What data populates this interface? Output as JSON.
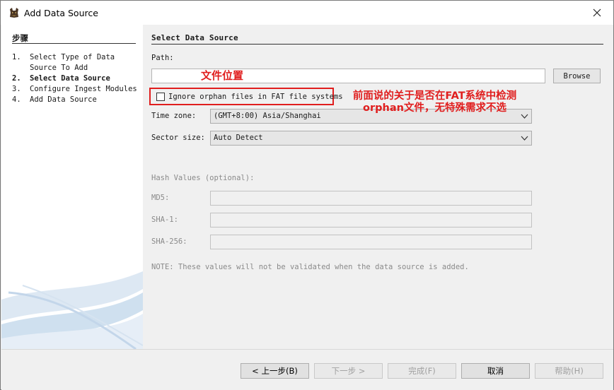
{
  "window": {
    "title": "Add Data Source"
  },
  "steps": {
    "heading": "步骤",
    "items": [
      {
        "num": "1.",
        "label": "Select Type of Data Source To Add",
        "active": false
      },
      {
        "num": "2.",
        "label": "Select Data Source",
        "active": true
      },
      {
        "num": "3.",
        "label": "Configure Ingest Modules",
        "active": false
      },
      {
        "num": "4.",
        "label": "Add Data Source",
        "active": false
      }
    ]
  },
  "form": {
    "section_title": "Select Data Source",
    "path_label": "Path:",
    "path_value": "",
    "browse_label": "Browse",
    "orphan_label": "Ignore orphan files in FAT file systems",
    "orphan_checked": false,
    "timezone_label": "Time zone:",
    "timezone_value": "(GMT+8:00) Asia/Shanghai",
    "sector_label": "Sector size:",
    "sector_value": "Auto Detect",
    "hash_heading": "Hash Values (optional):",
    "md5_label": "MD5:",
    "sha1_label": "SHA-1:",
    "sha256_label": "SHA-256:",
    "note": "NOTE: These values will not be validated when the data source is added."
  },
  "annotations": {
    "file_location": "文件位置",
    "orphan_note": "前面说的关于是否在FAT系统中检测 orphan文件，无特殊需求不选",
    "color": "#e01e1e"
  },
  "buttons": {
    "back": "< 上一步(B)",
    "next": "下一步 >",
    "finish": "完成(F)",
    "cancel": "取消",
    "help": "帮助(H)"
  }
}
